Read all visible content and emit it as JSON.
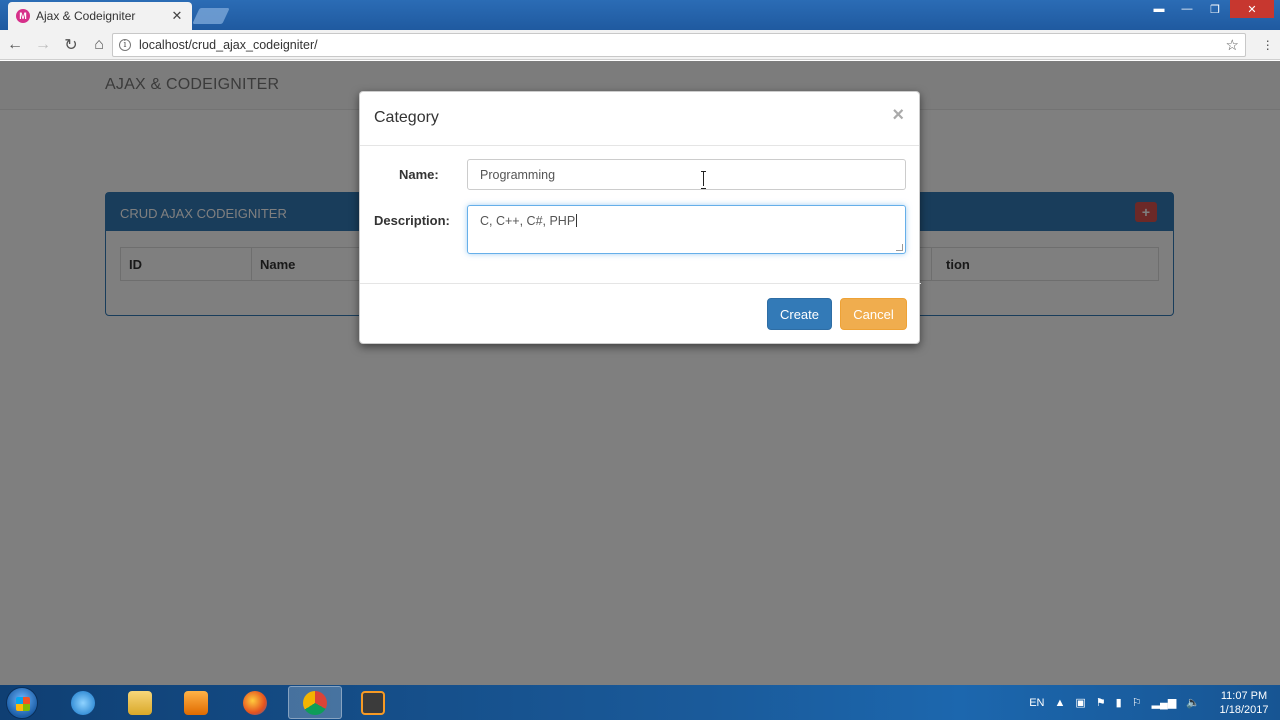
{
  "browser": {
    "tab_title": "Ajax & Codeigniter",
    "tab_favicon": "M",
    "url": "localhost/crud_ajax_codeigniter/"
  },
  "page": {
    "brand": "AJAX & CODEIGNITER",
    "panel_title": "CRUD AJAX CODEIGNITER",
    "columns": [
      "ID",
      "Name",
      "",
      "",
      "",
      "tion"
    ]
  },
  "modal": {
    "title": "Category",
    "close_symbol": "×",
    "name_label": "Name:",
    "name_value": "Programming",
    "description_label": "Description:",
    "description_value": "C, C++, C#, PHP",
    "create_label": "Create",
    "cancel_label": "Cancel"
  },
  "taskbar": {
    "language": "EN",
    "time": "11:07 PM",
    "date": "1/18/2017"
  },
  "colors": {
    "primary": "#337ab7",
    "warning": "#f0ad4e",
    "danger": "#d9534f"
  }
}
